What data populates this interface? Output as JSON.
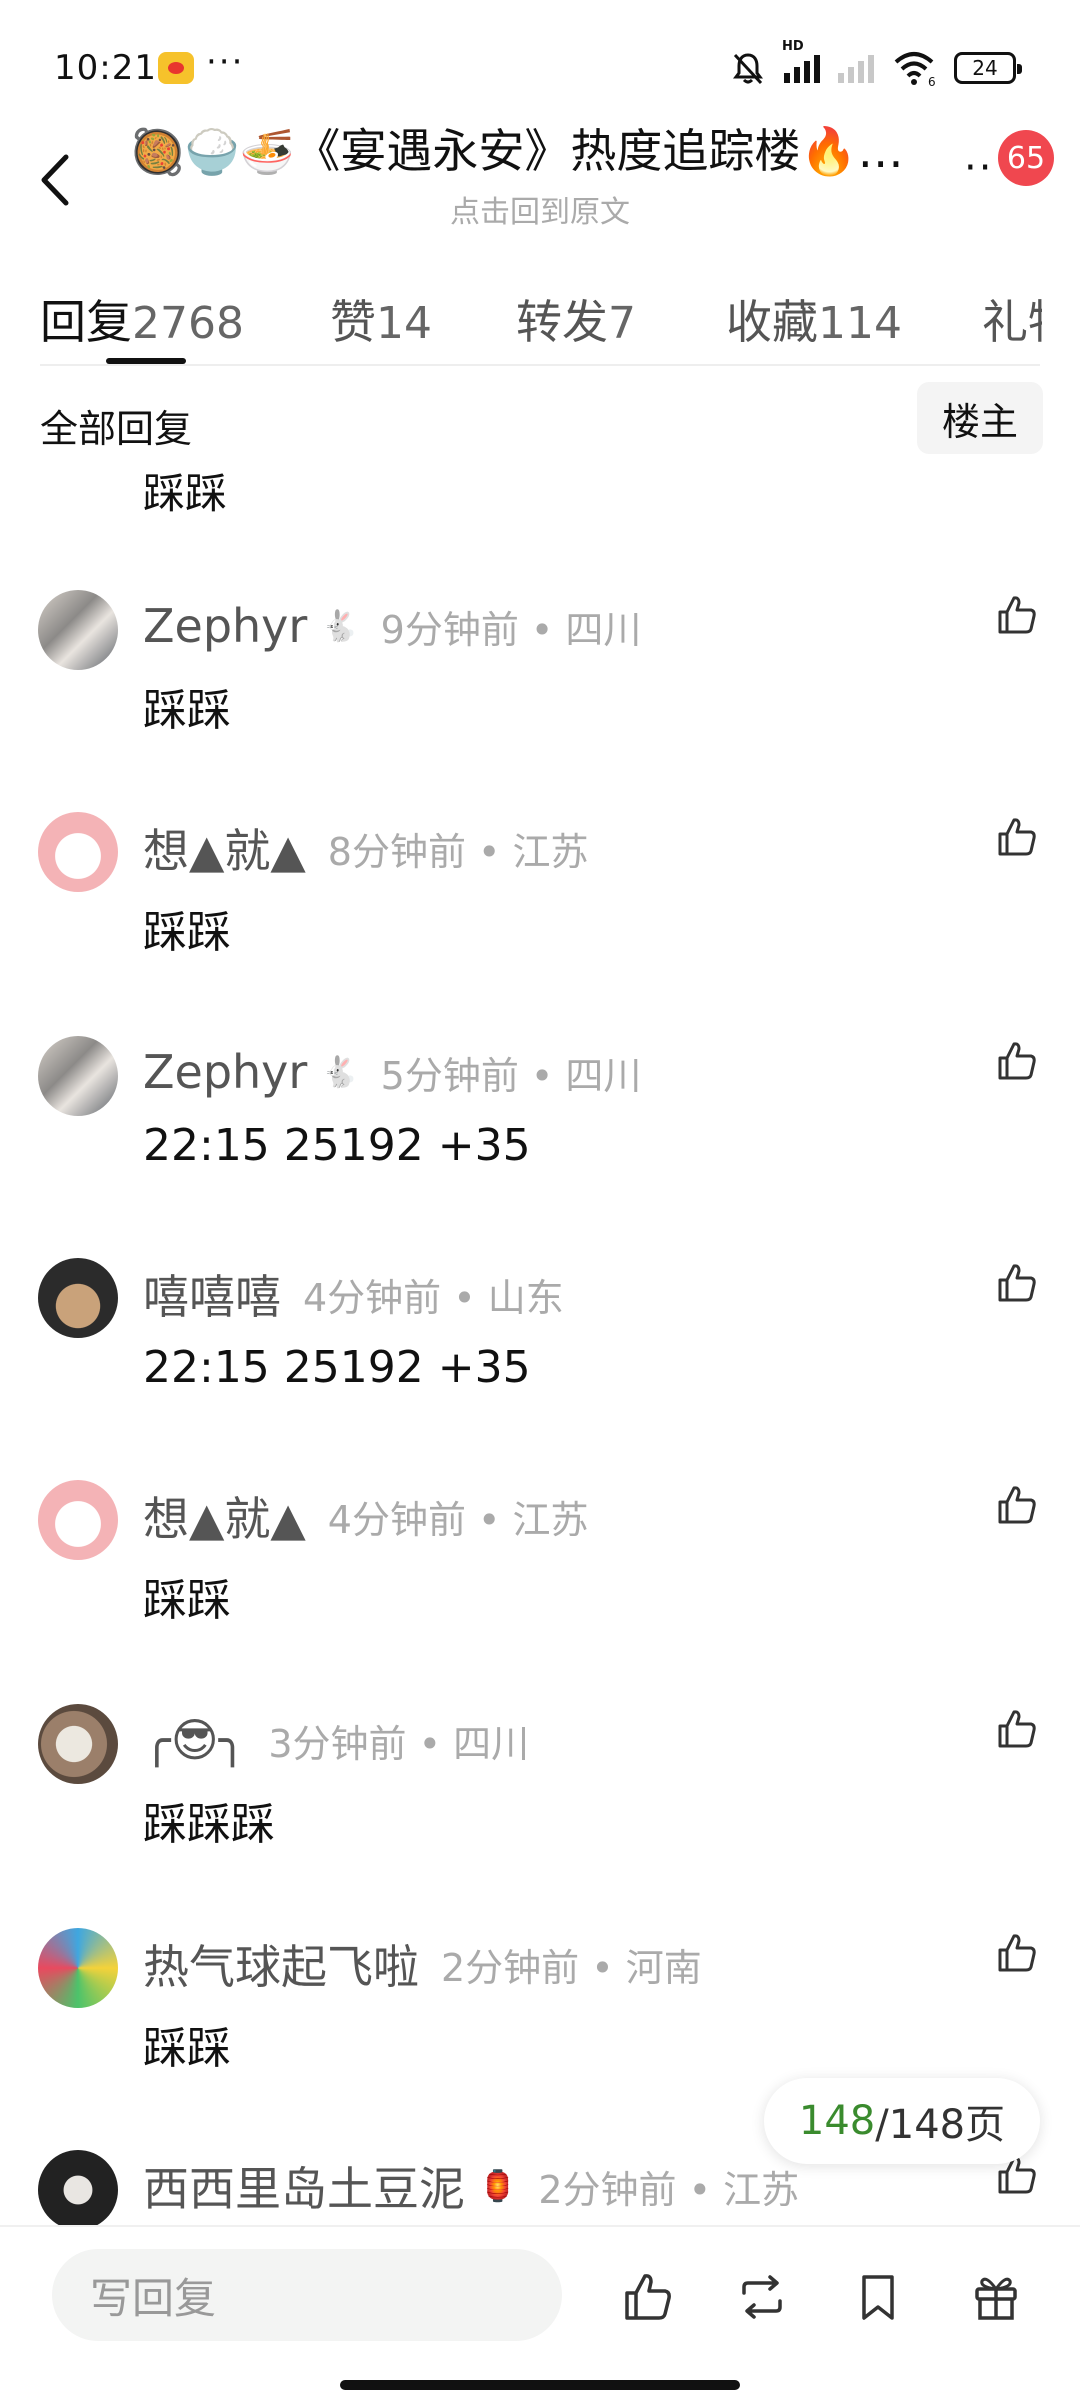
{
  "status_bar": {
    "time": "10:21",
    "more": "···",
    "hd_label": "HD",
    "wifi_sub": "6",
    "battery": "24"
  },
  "header": {
    "emojis": "🥘🍚🍜",
    "title": "《宴遇永安》热度追踪楼🔥…",
    "subtitle": "点击回到原文",
    "more": "··",
    "badge": "65"
  },
  "tabs": [
    {
      "label": "回复",
      "count": "2768",
      "active": true
    },
    {
      "label": "赞",
      "count": "14",
      "active": false
    },
    {
      "label": "转发",
      "count": "7",
      "active": false
    },
    {
      "label": "收藏",
      "count": "114",
      "active": false
    },
    {
      "label": "礼物",
      "count": "",
      "active": false
    }
  ],
  "filter": {
    "label": "全部回复",
    "owner_button": "楼主"
  },
  "partial_comment_text": "踩踩",
  "comments": [
    {
      "name": "Zephyr",
      "emoji": "🐇",
      "meta": "9分钟前 • 四川",
      "text": "踩踩",
      "avatar": "photo-group"
    },
    {
      "name": "想▲就▲",
      "emoji": "",
      "meta": "8分钟前 • 江苏",
      "text": "踩踩",
      "avatar": "pink-cartoon"
    },
    {
      "name": "Zephyr",
      "emoji": "🐇",
      "meta": "5分钟前 • 四川",
      "text": "22:15 25192 +35",
      "avatar": "photo-group"
    },
    {
      "name": "嘻嘻嘻",
      "emoji": "",
      "meta": "4分钟前 • 山东",
      "text": "22:15 25192 +35",
      "avatar": "cat"
    },
    {
      "name": "想▲就▲",
      "emoji": "",
      "meta": "4分钟前 • 江苏",
      "text": "踩踩",
      "avatar": "pink-cartoon"
    },
    {
      "name": "╭😎╮",
      "emoji": "",
      "meta": "3分钟前 • 四川",
      "text": "踩踩踩",
      "avatar": "plush"
    },
    {
      "name": "热气球起飞啦",
      "emoji": "",
      "meta": "2分钟前 • 河南",
      "text": "踩踩",
      "avatar": "colorful"
    },
    {
      "name": "西西里岛土豆泥",
      "emoji": "🏮",
      "meta": "2分钟前 • 江苏",
      "text": "",
      "avatar": "dark-photo"
    }
  ],
  "pager": {
    "current": "148",
    "total": "/148页"
  },
  "bottom_bar": {
    "reply_placeholder": "写回复",
    "icons": [
      "like-icon",
      "repost-icon",
      "bookmark-icon",
      "gift-icon"
    ]
  },
  "colors": {
    "badge": "#f0474f",
    "pager_current": "#3a8b2e",
    "meta_text": "#aaaaaa",
    "name_text": "#555555"
  }
}
